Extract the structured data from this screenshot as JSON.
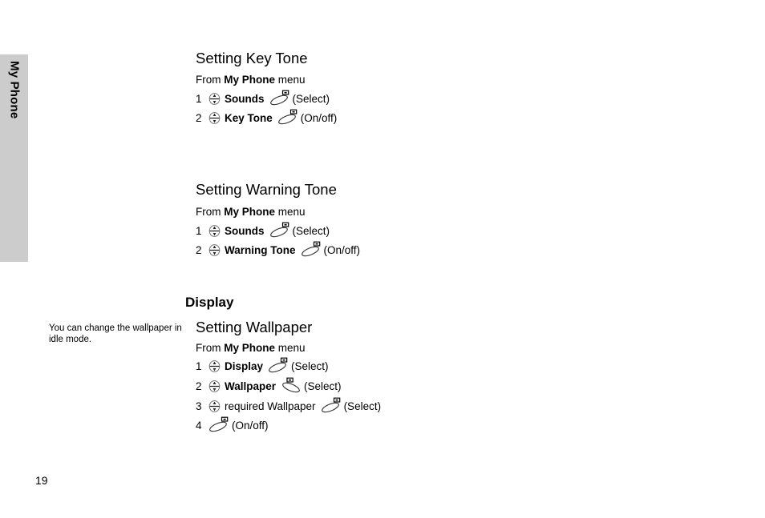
{
  "sidebar": {
    "tab_label": "My Phone"
  },
  "page": {
    "number": "19"
  },
  "margin_notes": [
    {
      "text": "You can change the wallpaper in idle mode."
    }
  ],
  "sections": [
    {
      "id": "setting-key-tone",
      "heading": "Setting Key Tone",
      "from_prefix": "From",
      "from_menu": "My Phone",
      "from_suffix": "menu",
      "steps": [
        {
          "num": "1",
          "scroll_icon": "scroll-updown-icon",
          "label": "Sounds",
          "bold": true,
          "soft_icon": "softkey-left-icon",
          "action": "(Select)"
        },
        {
          "num": "2",
          "scroll_icon": "scroll-updown-icon",
          "label": "Key Tone",
          "bold": true,
          "soft_icon": "softkey-left-icon",
          "action": "(On/off)"
        }
      ]
    },
    {
      "id": "setting-warning-tone",
      "heading": "Setting Warning Tone",
      "from_prefix": "From",
      "from_menu": "My Phone",
      "from_suffix": "menu",
      "steps": [
        {
          "num": "1",
          "scroll_icon": "scroll-updown-icon",
          "label": "Sounds",
          "bold": true,
          "soft_icon": "softkey-left-icon",
          "action": "(Select)"
        },
        {
          "num": "2",
          "scroll_icon": "scroll-updown-icon",
          "label": "Warning Tone",
          "bold": true,
          "soft_icon": "softkey-left-icon",
          "action": "(On/off)"
        }
      ]
    },
    {
      "id": "setting-wallpaper",
      "chapter": "Display",
      "heading": "Setting Wallpaper",
      "from_prefix": "From",
      "from_menu": "My Phone",
      "from_suffix": "menu",
      "steps": [
        {
          "num": "1",
          "scroll_icon": "scroll-updown-icon",
          "label": "Display",
          "bold": true,
          "soft_icon": "softkey-left-icon",
          "action": "(Select)"
        },
        {
          "num": "2",
          "scroll_icon": "scroll-updown-icon",
          "label": "Wallpaper",
          "bold": true,
          "soft_icon": "softkey-right-icon",
          "action": "(Select)"
        },
        {
          "num": "3",
          "scroll_icon": "scroll-updown-icon",
          "label": "required Wallpaper",
          "bold": false,
          "soft_icon": "softkey-left-icon",
          "action": "(Select)"
        },
        {
          "num": "4",
          "scroll_icon": null,
          "label": "",
          "bold": false,
          "soft_icon": "softkey-left-icon",
          "action": "(On/off)"
        }
      ]
    }
  ],
  "colors": {
    "tab_background": "#cccccc",
    "text": "#000000",
    "page_background": "#ffffff"
  }
}
